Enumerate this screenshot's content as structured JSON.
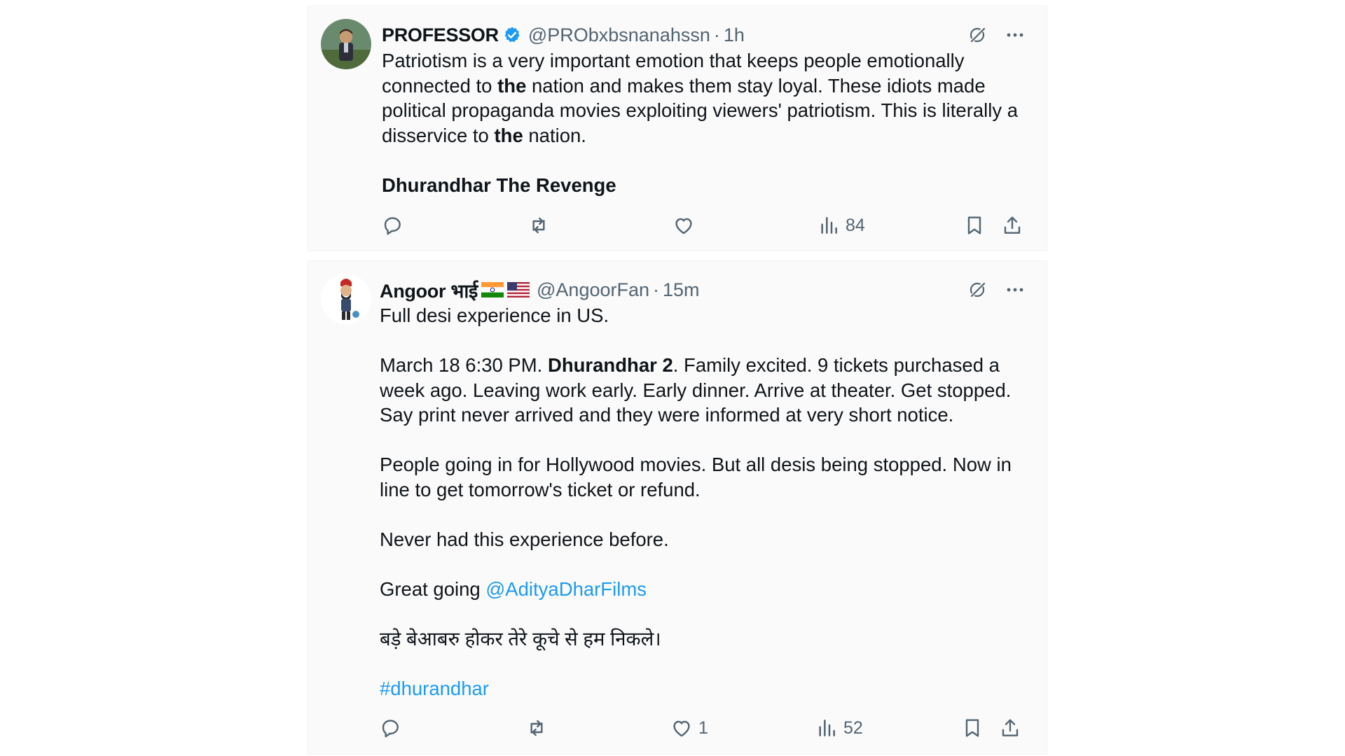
{
  "tweets": [
    {
      "author_name": "PROFESSOR",
      "handle": "@PRObxbsnanahssn",
      "separator": "·",
      "time": "1h",
      "paragraphs": [
        [
          {
            "t": "Patriotism is a very important emotion that keeps people emotionally connected to "
          },
          {
            "t": "the",
            "b": true
          },
          {
            "t": " nation and makes them stay loyal. These idiots made political propaganda movies exploiting viewers' patriotism. This is literally a disservice to "
          },
          {
            "t": "the",
            "b": true
          },
          {
            "t": " nation."
          }
        ],
        [
          {
            "t": "Dhurandhar The Revenge",
            "b": true
          }
        ]
      ],
      "views": "84",
      "likes": ""
    },
    {
      "author_name": "Angoor भाई",
      "handle": "@AngoorFan",
      "separator": "·",
      "time": "15m",
      "paragraphs": [
        [
          {
            "t": "Full desi experience in US."
          }
        ],
        [
          {
            "t": "March 18 6:30 PM. "
          },
          {
            "t": "Dhurandhar 2",
            "b": true
          },
          {
            "t": ". Family excited. 9 tickets purchased a week ago. Leaving work early. Early dinner. Arrive at theater. Get stopped. Say print never arrived and they were informed at very short notice."
          }
        ],
        [
          {
            "t": "People going in for Hollywood movies. But all desis being stopped. Now in line to get tomorrow's ticket or refund."
          }
        ],
        [
          {
            "t": "Never had this experience before."
          }
        ],
        [
          {
            "t": "Great going "
          },
          {
            "t": "@AdityaDharFilms",
            "link": true
          }
        ],
        [
          {
            "t": "बड़े बेआबरु होकर तेरे कूचे से हम निकले।"
          }
        ],
        [
          {
            "t": "#dhurandhar",
            "link": true
          }
        ]
      ],
      "views": "52",
      "likes": "1"
    }
  ],
  "colors": {
    "card_background": "#fafafa",
    "text": "#0f1419",
    "secondary_text": "#536471",
    "link": "#1d9bf0",
    "verified_badge": "#1d9bf0"
  },
  "icons": {
    "verified": "verified-badge-icon",
    "grok": "grok-icon",
    "more": "more-icon",
    "reply": "reply-icon",
    "retweet": "retweet-icon",
    "like": "heart-icon",
    "views": "views-icon",
    "bookmark": "bookmark-icon",
    "share": "share-icon",
    "flag_india": "india-flag-icon",
    "flag_us": "us-flag-icon"
  }
}
